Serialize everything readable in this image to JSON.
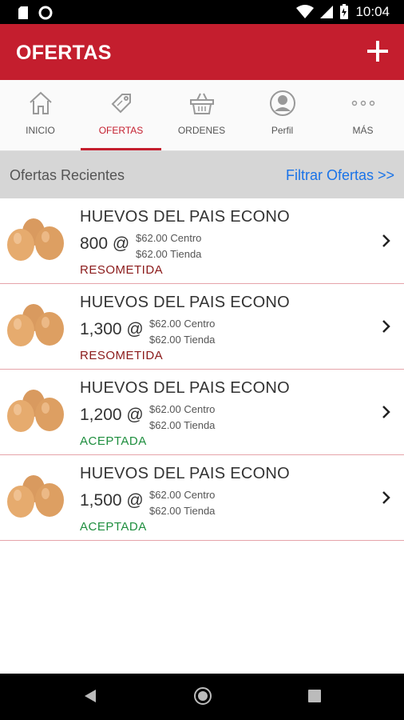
{
  "status_bar": {
    "time": "10:04"
  },
  "app_bar": {
    "title": "OFERTAS"
  },
  "tabs": [
    {
      "label": "INICIO",
      "icon": "home-icon"
    },
    {
      "label": "OFERTAS",
      "icon": "tag-icon",
      "active": true
    },
    {
      "label": "ORDENES",
      "icon": "basket-icon"
    },
    {
      "label": "Perfil",
      "icon": "profile-icon"
    },
    {
      "label": "MÁS",
      "icon": "more-icon"
    }
  ],
  "section": {
    "title": "Ofertas Recientes",
    "filter_link": "Filtrar Ofertas >>"
  },
  "offers": [
    {
      "product": "HUEVOS DEL PAIS ECONO",
      "quantity": "800 @",
      "price_center": "$62.00 Centro",
      "price_store": "$62.00 Tienda",
      "status": "RESOMETIDA",
      "status_color": "#8b1a1a"
    },
    {
      "product": "HUEVOS DEL PAIS ECONO",
      "quantity": "1,300 @",
      "price_center": "$62.00 Centro",
      "price_store": "$62.00 Tienda",
      "status": "RESOMETIDA",
      "status_color": "#8b1a1a"
    },
    {
      "product": "HUEVOS DEL PAIS ECONO",
      "quantity": "1,200 @",
      "price_center": "$62.00 Centro",
      "price_store": "$62.00 Tienda",
      "status": "ACEPTADA",
      "status_color": "#1e8e3e"
    },
    {
      "product": "HUEVOS DEL PAIS ECONO",
      "quantity": "1,500 @",
      "price_center": "$62.00 Centro",
      "price_store": "$62.00 Tienda",
      "status": "ACEPTADA",
      "status_color": "#1e8e3e"
    }
  ],
  "colors": {
    "primary": "#c41e2e",
    "link": "#1a73e8"
  }
}
